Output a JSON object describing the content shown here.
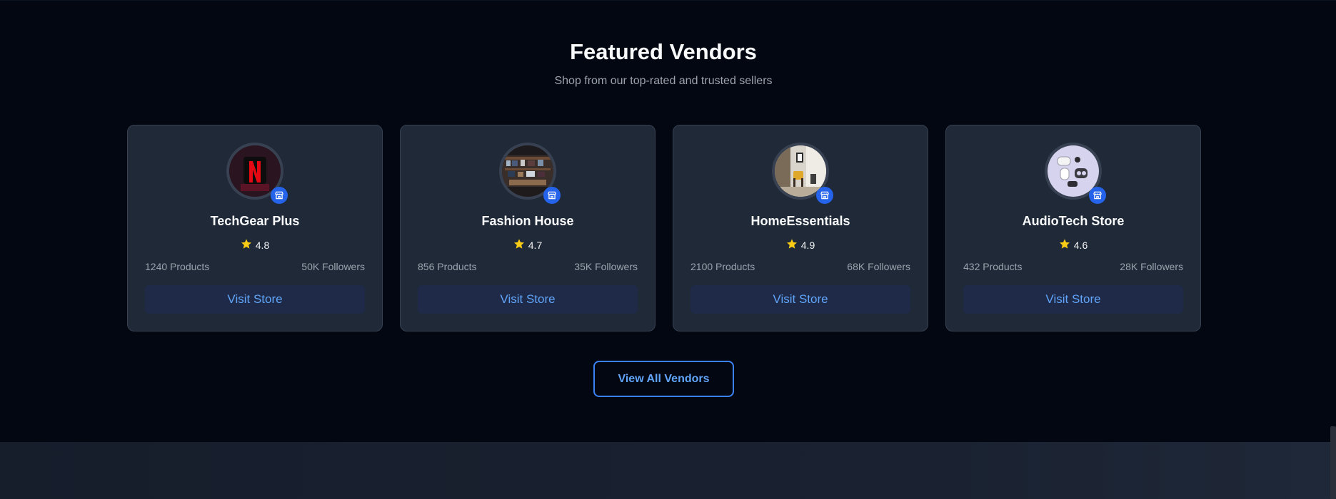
{
  "section": {
    "title": "Featured Vendors",
    "subtitle": "Shop from our top-rated and trusted sellers",
    "view_all_label": "View All Vendors"
  },
  "vendors": [
    {
      "name": "TechGear Plus",
      "rating": "4.8",
      "products": "1240 Products",
      "followers": "50K Followers",
      "cta": "Visit Store",
      "avatar": "netflix-logo-image"
    },
    {
      "name": "Fashion House",
      "rating": "4.7",
      "products": "856 Products",
      "followers": "35K Followers",
      "cta": "Visit Store",
      "avatar": "store-shelves-image"
    },
    {
      "name": "HomeEssentials",
      "rating": "4.9",
      "products": "2100 Products",
      "followers": "68K Followers",
      "cta": "Visit Store",
      "avatar": "living-room-image"
    },
    {
      "name": "AudioTech Store",
      "rating": "4.6",
      "products": "432 Products",
      "followers": "28K Followers",
      "cta": "Visit Store",
      "avatar": "earbuds-image"
    }
  ],
  "colors": {
    "background": "#030712",
    "card": "#1f2937",
    "accent": "#3b82f6",
    "star": "#facc15"
  },
  "icons": {
    "badge": "store-icon",
    "rating": "star-icon"
  }
}
